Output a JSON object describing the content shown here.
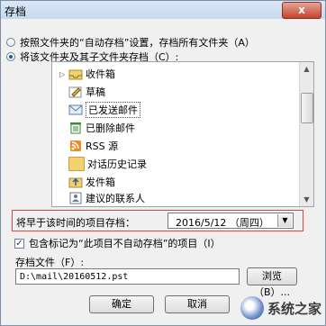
{
  "window": {
    "title": "存档",
    "close_glyph": "x"
  },
  "options": [
    {
      "label": "按照文件夹的“自动存档”设置，存档所有文件夹（A）",
      "checked": false
    },
    {
      "label": "将该文件夹及其子文件夹存档（C）:",
      "checked": true
    }
  ],
  "folders": [
    {
      "label": "收件箱",
      "icon": "inbox-icon",
      "expandable": true
    },
    {
      "label": "草稿",
      "icon": "drafts-icon",
      "expandable": false
    },
    {
      "label": "已发送邮件",
      "icon": "sent-icon",
      "expandable": false,
      "selected": true
    },
    {
      "label": "已删除邮件",
      "icon": "deleted-icon",
      "expandable": false
    },
    {
      "label": "RSS 源",
      "icon": "rss-icon",
      "expandable": false
    },
    {
      "label": "对话历史记录",
      "icon": "folder-icon",
      "expandable": false
    },
    {
      "label": "发件箱",
      "icon": "outbox-icon",
      "expandable": false
    },
    {
      "label": "建议的联系人",
      "icon": "contacts-icon",
      "expandable": false
    }
  ],
  "archive_before": {
    "label": "将早于该时间的项目存档：",
    "value": "2016/5/12 （周四）"
  },
  "no_autoarchive": {
    "label": "包含标记为“此项目不自动存档”的项目（I）",
    "checked": true
  },
  "archive_file": {
    "label": "存档文件（F）:",
    "value": "D:\\mail\\20160512.pst"
  },
  "buttons": {
    "browse": "浏览（B）...",
    "ok": "确定",
    "cancel": "取消"
  },
  "watermark": {
    "text": "系统之家"
  },
  "colors": {
    "accent": "#1e5aa8",
    "highlight_border": "#dd4444"
  }
}
